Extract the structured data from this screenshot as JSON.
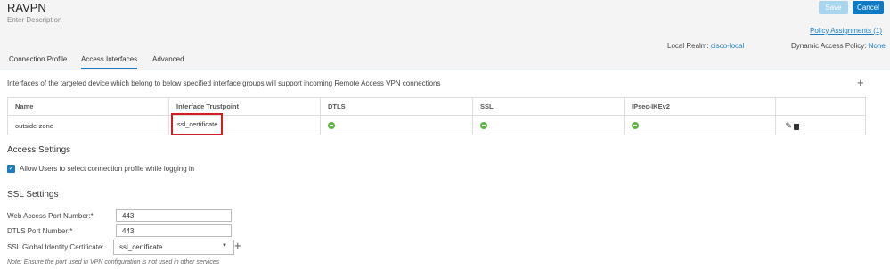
{
  "header": {
    "title": "RAVPN",
    "description": "Enter Description",
    "save_label": "Save",
    "cancel_label": "Cancel",
    "policy_assignments": "Policy Assignments (1)",
    "local_realm_label": "Local Realm:",
    "local_realm_value": "cisco-local",
    "dap_label": "Dynamic Access Policy:",
    "dap_value": "None"
  },
  "tabs": [
    {
      "label": "Connection Profile",
      "active": false
    },
    {
      "label": "Access Interfaces",
      "active": true
    },
    {
      "label": "Advanced",
      "active": false
    }
  ],
  "main": {
    "intro": "Interfaces of the targeted device which belong to below specified interface groups will support incoming Remote Access VPN connections",
    "add_icon": "+",
    "table": {
      "headers": [
        "Name",
        "Interface Trustpoint",
        "DTLS",
        "SSL",
        "IPsec-IKEv2"
      ],
      "rows": [
        {
          "name": "outside-zone",
          "trustpoint": "ssl_certificate",
          "dtls": "enabled",
          "ssl": "enabled",
          "ipsec": "enabled"
        }
      ]
    },
    "access_settings": {
      "title": "Access Settings",
      "allow_select_label": "Allow Users to select connection profile while logging in",
      "allow_select_checked": true
    },
    "ssl_settings": {
      "title": "SSL Settings",
      "web_port_label": "Web Access Port Number:*",
      "web_port_value": "443",
      "dtls_port_label": "DTLS Port Number:*",
      "dtls_port_value": "443",
      "cert_label": "SSL Global Identity Certificate:",
      "cert_value": "ssl_certificate",
      "add_icon": "+",
      "note": "Note: Ensure the port used in VPN configuration is not used in other services"
    }
  },
  "colors": {
    "accent": "#1d7bbf",
    "highlight": "#d31d24",
    "status_ok": "#58b83f"
  }
}
